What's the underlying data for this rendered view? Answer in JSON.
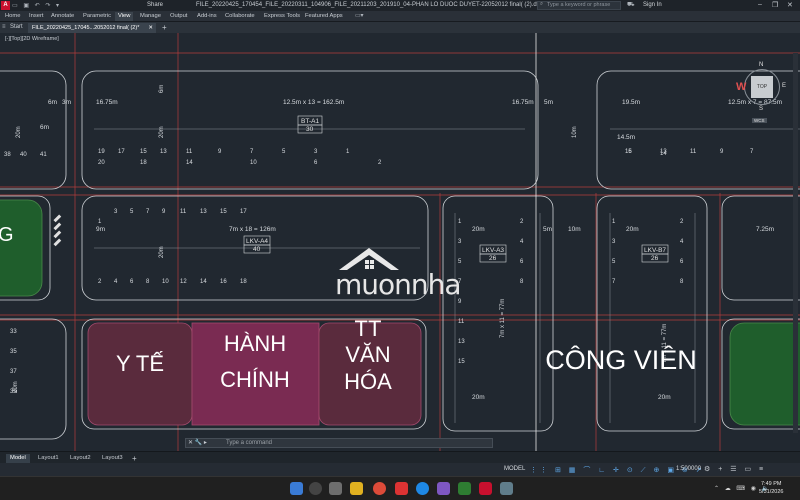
{
  "titlebar": {
    "share": "Share",
    "document_title": "FILE_20220425_170454_FILE_20220311_104906_FILE_20211203_201910_04-PHAN LO DUOC DUYET-22052012 final( (2).dwg",
    "search_placeholder": "Type a keyword or phrase",
    "signin": "Sign In"
  },
  "ribbon": {
    "tabs": [
      "Home",
      "Insert",
      "Annotate",
      "Parametric",
      "View",
      "Manage",
      "Output",
      "Add-ins",
      "Collaborate",
      "Express Tools",
      "Featured Apps"
    ],
    "active": "View"
  },
  "doc_tabs": {
    "start": "Start",
    "file_tab": "FILE_20220425_17045...2052012 final( (2)*"
  },
  "viewport": {
    "view_label": "[-][Top][2D Wireframe]",
    "compass": {
      "top": "TOP",
      "n": "N",
      "s": "S",
      "w": "W",
      "e": "E",
      "wcs": "WCS"
    },
    "labels": {
      "bt_a1": "BT-A1",
      "bt_a1_n": "30",
      "lkv_a4": "LKV-A4",
      "lkv_a4_n": "40",
      "lkv_a3": "LKV-A3",
      "lkv_a3_n": "26",
      "lkv_b7": "LKV-B7",
      "lkv_b7_n": "26",
      "yte": "Y TẾ",
      "hanhchinh_1": "HÀNH",
      "hanhchinh_2": "CHÍNH",
      "ttvh_1": "TT",
      "ttvh_2": "VĂN",
      "ttvh_3": "HÓA",
      "congvien": "CÔNG VIÊN",
      "dim_top_mid": "12.5m x 13 = 162.5m",
      "dim_top_right": "12.5m x 7 = 87.5m",
      "dim_mid_left": "7m x 18 = 126m",
      "dim_vert_1": "7m x 11 = 77m",
      "dim_vert_2": "7m x 11 = 77m",
      "d_1675a": "16.75m",
      "d_1675b": "16.75m",
      "d_195": "19.5m",
      "d_145": "14.5m",
      "d_6m": "6m",
      "d_3m": "3m",
      "d_5m": "5m",
      "d_9m": "9m",
      "d_10m": "10m",
      "d_20m": "20m",
      "d_725": "7.25m",
      "g": "G"
    }
  },
  "command": {
    "placeholder": "Type a command"
  },
  "layouts": {
    "tabs": [
      "Model",
      "Layout1",
      "Layout2",
      "Layout3"
    ],
    "active": "Model"
  },
  "status": {
    "model": "MODEL",
    "scale": "1:500000"
  },
  "taskbar": {
    "time": "7:49 PM",
    "date": "5/31/2026"
  },
  "watermark": {
    "text": "muonnha"
  }
}
